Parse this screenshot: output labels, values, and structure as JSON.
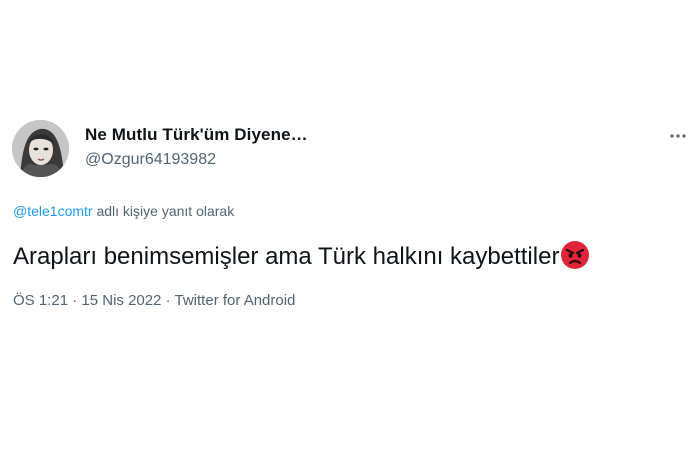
{
  "tweet": {
    "display_name": "Ne Mutlu Türk'üm Diyene…",
    "handle": "@Ozgur64193982",
    "reply_mention": "@tele1comtr",
    "reply_suffix": " adlı kişiye yanıt olarak",
    "text": "Arapları benimsemişler ama Türk halkını kaybettiler",
    "emoji": "angry-face-emoji",
    "time": "ÖS 1:21",
    "separator1": " · ",
    "date": "15 Nis 2022",
    "separator2": " · ",
    "source": "Twitter for Android"
  },
  "icons": {
    "more": "more-options-icon",
    "avatar": "profile-avatar"
  },
  "colors": {
    "text_primary": "#0f1419",
    "text_secondary": "#536471",
    "link": "#1d9bf0",
    "emoji_red": "#e0243a"
  }
}
